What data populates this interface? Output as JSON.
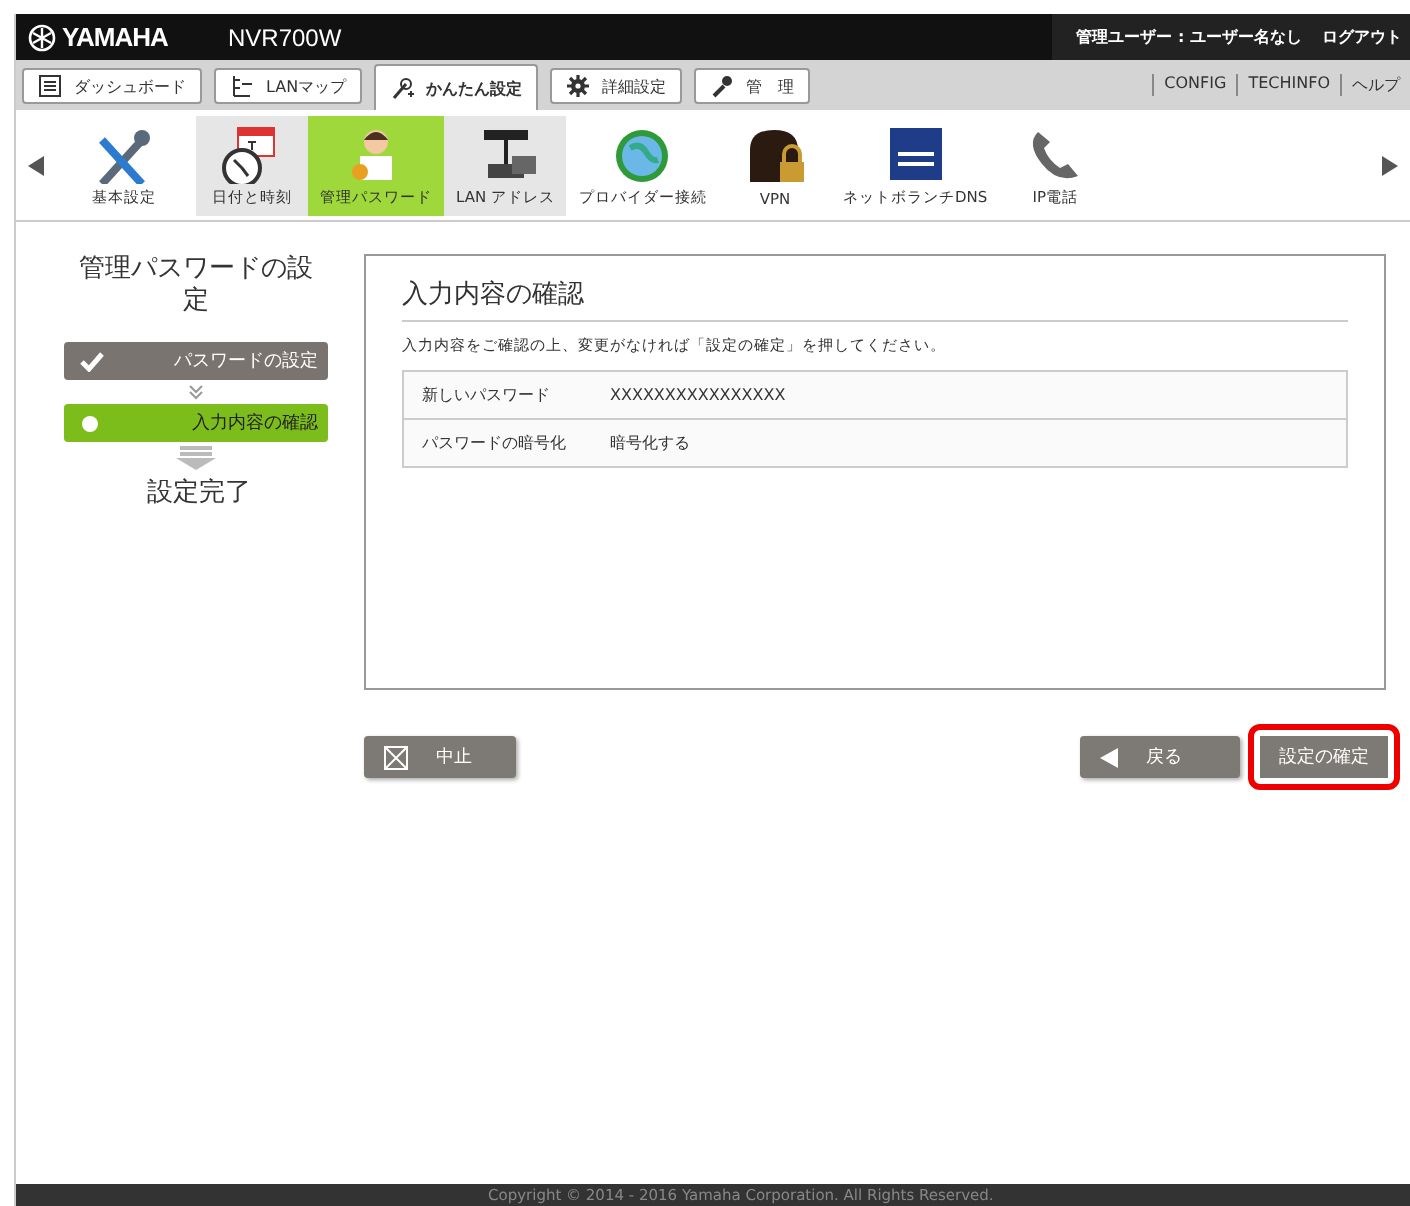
{
  "header": {
    "brand": "YAMAHA",
    "model": "NVR700W",
    "user": "管理ユーザー : ユーザー名なし",
    "logout": "ログアウト"
  },
  "tabs": [
    {
      "label": "ダッシュボード",
      "selected": false
    },
    {
      "label": "LANマップ",
      "selected": false
    },
    {
      "label": "かんたん設定",
      "selected": true
    },
    {
      "label": "詳細設定",
      "selected": false
    },
    {
      "label": "管　理",
      "selected": false
    }
  ],
  "top_links": [
    "CONFIG",
    "TECHINFO",
    "ヘルプ"
  ],
  "nav_items": [
    {
      "label": "基本設定",
      "kind": "main",
      "selected": false
    },
    {
      "label": "日付と時刻",
      "kind": "sub",
      "selected": false
    },
    {
      "label": "管理パスワード",
      "kind": "sub",
      "selected": true
    },
    {
      "label": "LAN アドレス",
      "kind": "sub",
      "selected": false
    },
    {
      "label": "プロバイダー接続",
      "kind": "main",
      "selected": false
    },
    {
      "label": "VPN",
      "kind": "main",
      "selected": false
    },
    {
      "label": "ネットボランチDNS",
      "kind": "main",
      "selected": false
    },
    {
      "label": "IP電話",
      "kind": "main",
      "selected": false
    }
  ],
  "wizard": {
    "title": "管理パスワードの設定",
    "steps": [
      {
        "label": "パスワードの設定",
        "kind": "done"
      },
      {
        "label": "入力内容の確認",
        "kind": "current"
      },
      {
        "label": "設定完了",
        "kind": "pending"
      }
    ]
  },
  "panel": {
    "title": "入力内容の確認",
    "description": "入力内容をご確認の上、変更がなければ「設定の確定」を押してください。",
    "rows": [
      {
        "label": "新しいパスワード",
        "value": "XXXXXXXXXXXXXXXX"
      },
      {
        "label": "パスワードの暗号化",
        "value": "暗号化する"
      }
    ]
  },
  "buttons": [
    {
      "label": "中止",
      "kind": "cancel",
      "highlighted": false
    },
    {
      "label": "戻る",
      "kind": "back",
      "highlighted": false
    },
    {
      "label": "設定の確定",
      "kind": "confirm",
      "highlighted": true
    }
  ],
  "footer": "Copyright © 2014 - 2016 Yamaha Corporation. All Rights Reserved."
}
